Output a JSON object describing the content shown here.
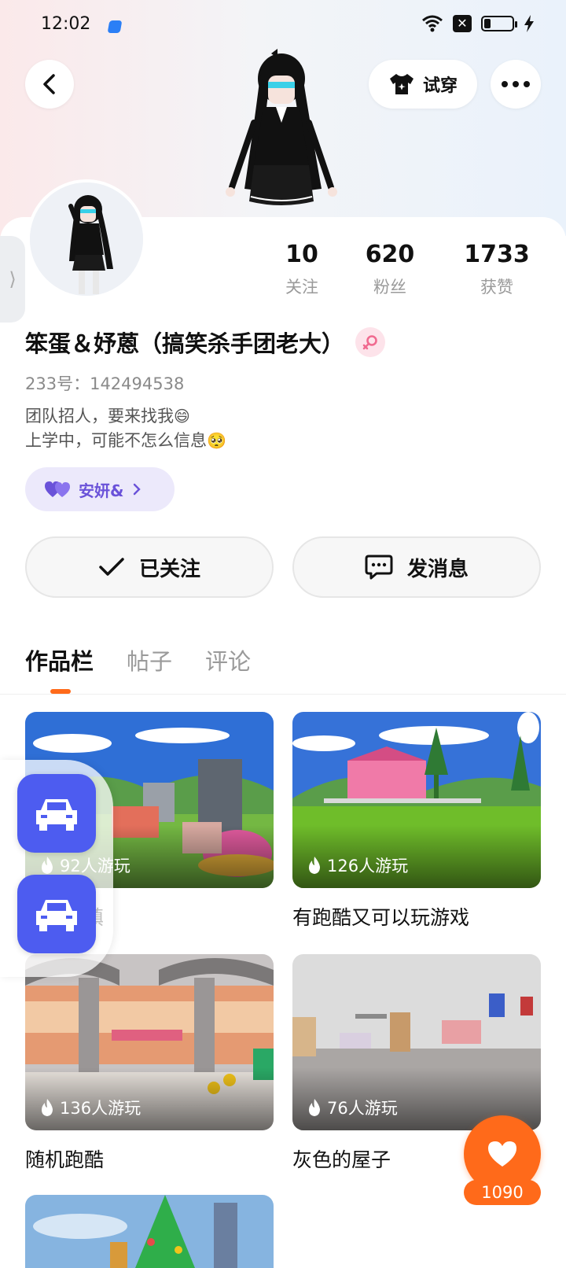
{
  "status_bar": {
    "time": "12:02"
  },
  "header": {
    "tryon_label": "试穿"
  },
  "profile": {
    "stats": [
      {
        "value": "10",
        "label": "关注"
      },
      {
        "value": "620",
        "label": "粉丝"
      },
      {
        "value": "1733",
        "label": "获赞"
      }
    ],
    "name": "笨蛋＆妤蒽（搞笑杀手团老大）",
    "id_line": "233号：142494538",
    "bio_line1": "团队招人，要来找我",
    "bio_line1_emoji": "😄",
    "bio_line2": "上学中，可能不怎么信息",
    "bio_line2_emoji": "🥺",
    "cp_tag": "安妍&"
  },
  "actions": {
    "follow_label": "已关注",
    "message_label": "发消息"
  },
  "tabs": [
    {
      "label": "作品栏",
      "active": true
    },
    {
      "label": "帖子",
      "active": false
    },
    {
      "label": "评论",
      "active": false
    }
  ],
  "games": [
    {
      "title": "梦幻小镇",
      "plays": "92人游玩"
    },
    {
      "title": "有跑酷又可以玩游戏",
      "plays": "126人游玩"
    },
    {
      "title": "随机跑酷",
      "plays": "136人游玩"
    },
    {
      "title": "灰色的屋子",
      "plays": "76人游玩"
    }
  ],
  "likes": {
    "count": "1090"
  },
  "colors": {
    "accent": "#ff6a1a",
    "float_button": "#4d5cf0",
    "cp_text": "#6a52d9"
  }
}
